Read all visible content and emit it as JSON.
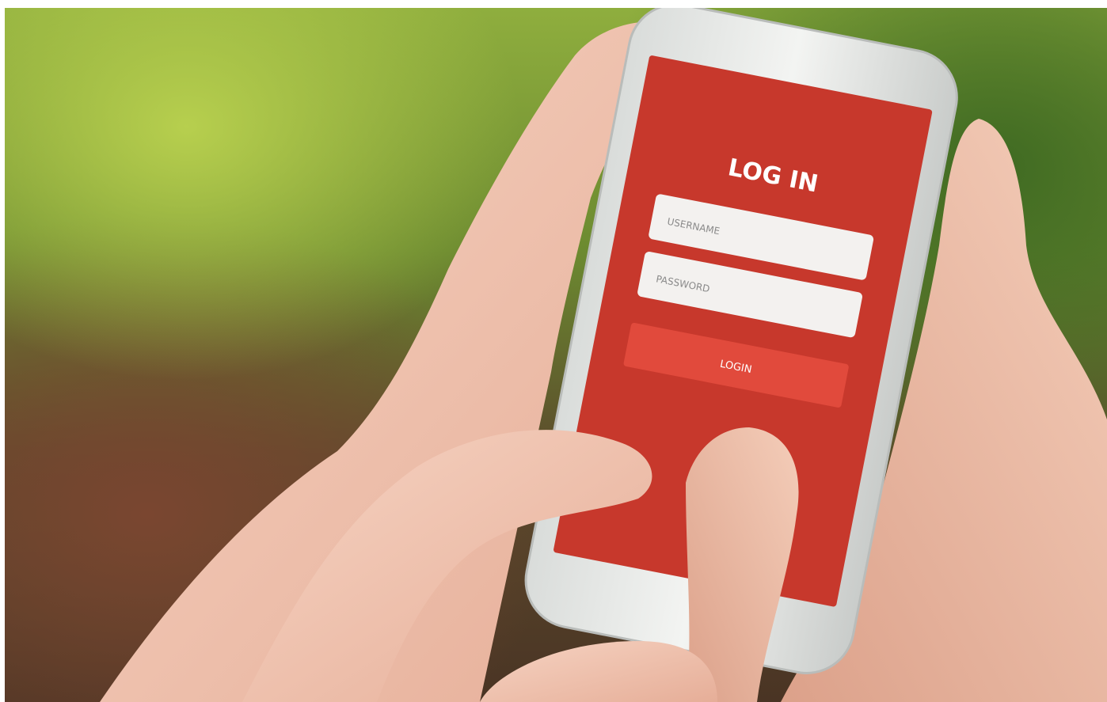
{
  "login_screen": {
    "title": "LOG IN",
    "username_placeholder": "USERNAME",
    "password_placeholder": "PASSWORD",
    "login_button_label": "LOGIN"
  },
  "colors": {
    "screen_red": "#c7382c",
    "button_red": "#e14a3c",
    "field_white": "#f3f1ef",
    "phone_body": "#e9ecea",
    "skin": "#f1c6b2"
  }
}
